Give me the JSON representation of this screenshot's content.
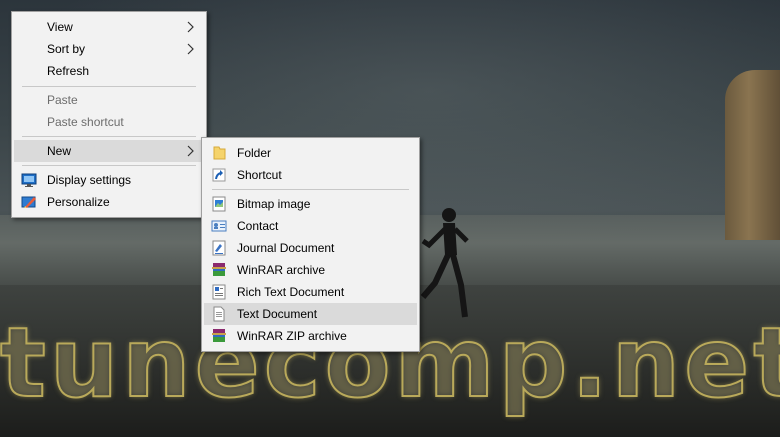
{
  "watermark": "tunecomp.net",
  "context_menu": {
    "view": "View",
    "sort_by": "Sort by",
    "refresh": "Refresh",
    "paste": "Paste",
    "paste_shortcut": "Paste shortcut",
    "new": "New",
    "display_settings": "Display settings",
    "personalize": "Personalize"
  },
  "new_submenu": {
    "folder": "Folder",
    "shortcut": "Shortcut",
    "bitmap_image": "Bitmap image",
    "contact": "Contact",
    "journal_document": "Journal Document",
    "winrar_archive": "WinRAR archive",
    "rich_text_document": "Rich Text Document",
    "text_document": "Text Document",
    "winrar_zip_archive": "WinRAR ZIP archive"
  },
  "colors": {
    "menu_background": "#f2f2f2",
    "highlight": "#dadada",
    "disabled_text": "#6d6d6d"
  }
}
